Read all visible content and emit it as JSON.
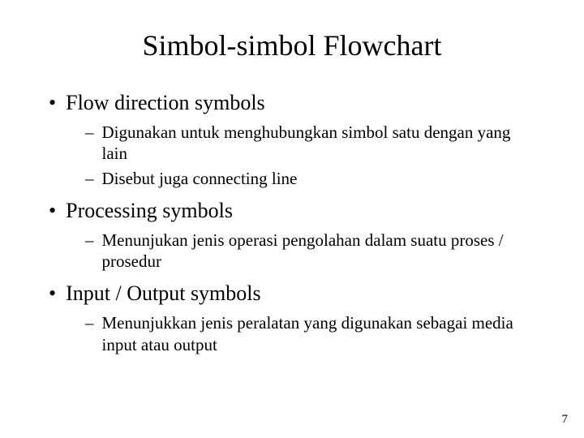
{
  "title": "Simbol-simbol Flowchart",
  "sections": [
    {
      "heading": "Flow direction symbols",
      "points": [
        "Digunakan untuk menghubungkan simbol satu dengan yang lain",
        "Disebut juga connecting line"
      ]
    },
    {
      "heading": "Processing symbols",
      "points": [
        "Menunjukan jenis operasi pengolahan dalam suatu proses / prosedur"
      ]
    },
    {
      "heading": "Input / Output symbols",
      "points": [
        "Menunjukkan jenis peralatan yang digunakan sebagai media input atau output"
      ]
    }
  ],
  "pageNumber": "7",
  "bulletChar": "•",
  "dashChar": "–"
}
